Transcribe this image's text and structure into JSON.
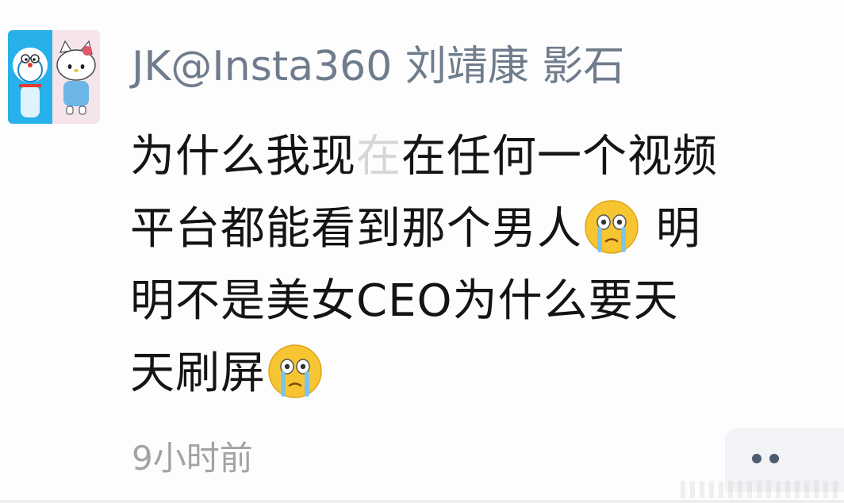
{
  "comment": {
    "username": "JK@Insta360 刘靖康 影石",
    "lines": [
      {
        "pre": "为什么我现",
        "ghost": "在",
        "post": "在任何一个视频"
      },
      {
        "text": "平台都能看到那个男人",
        "tail": " 明"
      },
      {
        "text": "明不是美女CEO为什么要天"
      },
      {
        "text": "天刷屏"
      }
    ],
    "time": "9小时前"
  },
  "icons": {
    "avatar": "doraemon-hellokitty-avatar",
    "emoji": "crying-face-emoji",
    "more": "more-dots-icon"
  },
  "colors": {
    "username": "#6f7c8c",
    "text": "#141414",
    "time": "#a3a3a3",
    "emoji_face": "#f7c531"
  }
}
